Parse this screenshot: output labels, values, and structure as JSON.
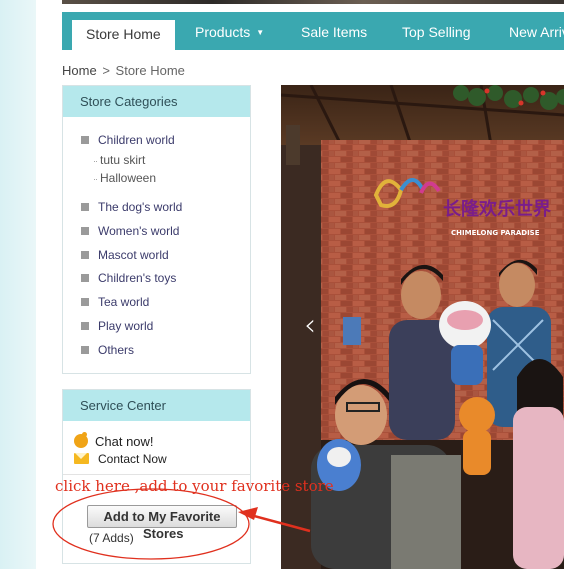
{
  "nav": {
    "items": [
      {
        "label": "Store Home",
        "active": true
      },
      {
        "label": "Products",
        "has_dropdown": true
      },
      {
        "label": "Sale Items"
      },
      {
        "label": "Top Selling"
      },
      {
        "label": "New Arrivals"
      }
    ],
    "accent": "#3aa8b0"
  },
  "breadcrumb": {
    "home": "Home",
    "separator": ">",
    "current": "Store Home"
  },
  "categories": {
    "title": "Store Categories",
    "items": [
      {
        "label": "Children world",
        "subitems": [
          "tutu skirt",
          "Halloween"
        ]
      },
      {
        "label": "The dog's world"
      },
      {
        "label": "Women's world"
      },
      {
        "label": "Mascot world"
      },
      {
        "label": "Children's toys"
      },
      {
        "label": "Tea world"
      },
      {
        "label": "Play world"
      },
      {
        "label": "Others"
      }
    ]
  },
  "service": {
    "title": "Service Center",
    "chat_label": "Chat now!",
    "contact_label": "Contact Now",
    "chat_icon": "chat-bubble-icon",
    "contact_icon": "envelope-icon"
  },
  "favorite": {
    "button_label": "Add to My Favorite",
    "stores_label": "Stores",
    "count_label": "(7 Adds)"
  },
  "annotation": {
    "text": "click here ,add to your favorite store",
    "color": "#e0301e"
  },
  "hero": {
    "sign_text": "CHIMELONG PARADISE",
    "sign_cn": "长隆欢乐世界",
    "prev_icon": "chevron-left-icon"
  }
}
